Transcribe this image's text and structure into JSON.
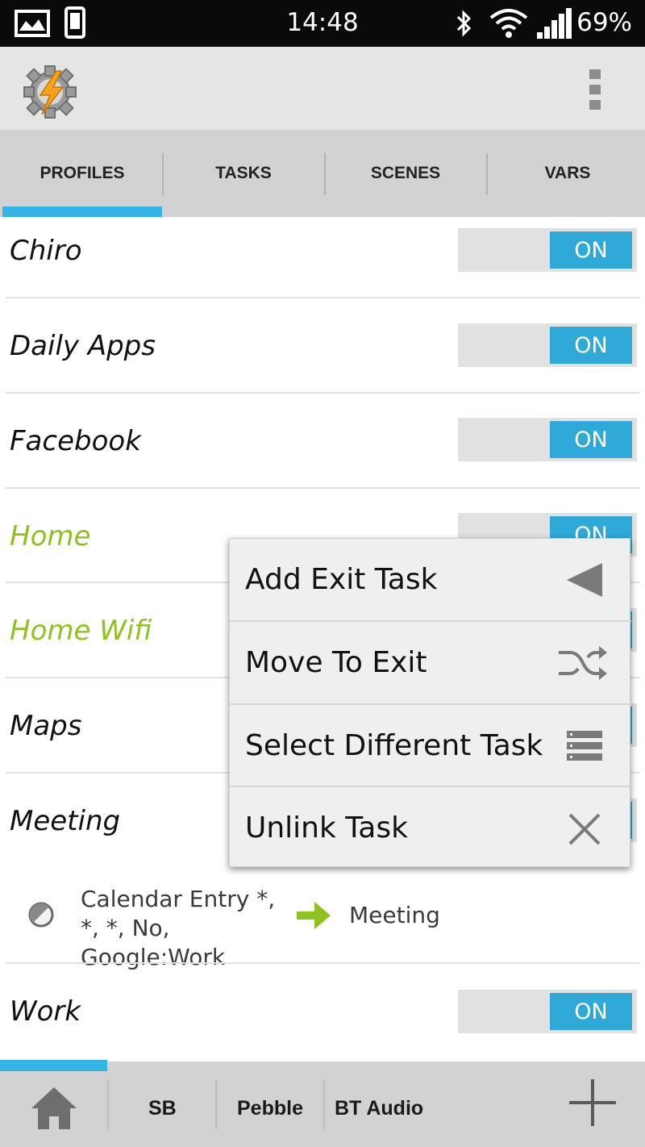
{
  "status_bar": {
    "time": "14:48",
    "battery": "69%"
  },
  "tabs": [
    {
      "label": "PROFILES",
      "selected": true
    },
    {
      "label": "TASKS"
    },
    {
      "label": "SCENES"
    },
    {
      "label": "VARS"
    }
  ],
  "profiles": [
    {
      "name": "Chiro",
      "toggle": "ON"
    },
    {
      "name": "Daily Apps",
      "toggle": "ON"
    },
    {
      "name": "Facebook",
      "toggle": "ON"
    },
    {
      "name": "Home",
      "toggle": "ON",
      "active": true
    },
    {
      "name": "Home Wifi",
      "active": true
    },
    {
      "name": "Maps"
    },
    {
      "name": "Meeting"
    },
    {
      "name": "Work",
      "toggle": "ON"
    }
  ],
  "meeting_detail": {
    "context": "Calendar Entry *, *, *, No, Google:Work",
    "task": "Meeting"
  },
  "context_menu": [
    {
      "label": "Add Exit Task",
      "icon": "triangle-left-icon"
    },
    {
      "label": "Move To Exit",
      "icon": "shuffle-icon"
    },
    {
      "label": "Select Different Task",
      "icon": "list-icon"
    },
    {
      "label": "Unlink Task",
      "icon": "close-icon"
    }
  ],
  "bottom_bar": {
    "home_icon": "home-icon",
    "projects": [
      "SB",
      "Pebble",
      "BT Audio"
    ],
    "add_icon": "plus-icon"
  },
  "colors": {
    "accent": "#33b5e5",
    "active_profile": "#8ec21f",
    "toggle_on": "#2fa9d8"
  }
}
